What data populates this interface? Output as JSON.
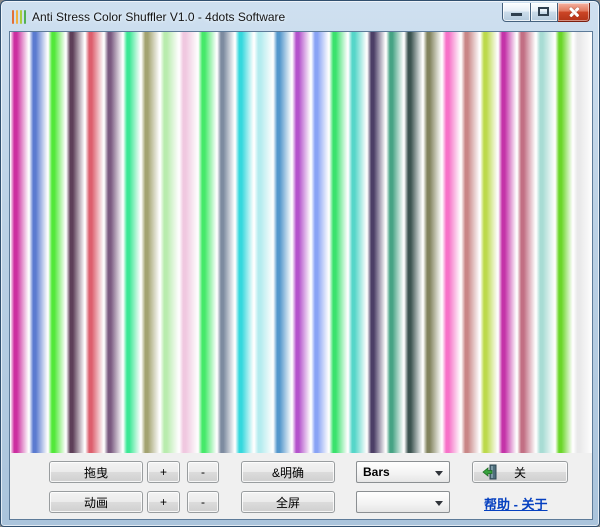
{
  "window": {
    "title": "Anti Stress Color Shuffler V1.0 - 4dots Software"
  },
  "bars": {
    "count": 31,
    "gradient_style": "white edge to saturated peak near 25% fading back to white",
    "colors": [
      "#cc2fa0",
      "#5b7bd0",
      "#52e83a",
      "#5e3f58",
      "#dd5f6d",
      "#7a5a80",
      "#3ce896",
      "#a3a371",
      "#b9ecae",
      "#f0c8e0",
      "#46e96a",
      "#7d8ba0",
      "#35d8dd",
      "#b5ecef",
      "#5497cc",
      "#b453cc",
      "#89a3f5",
      "#3be26d",
      "#56d6c9",
      "#4c3f66",
      "#46a384",
      "#3d5451",
      "#83845f",
      "#f772c8",
      "#c98787",
      "#bcd94b",
      "#c434a8",
      "#c26f84",
      "#a8dcd4",
      "#6ad628",
      "#e9e9ea"
    ]
  },
  "controls": {
    "row1": {
      "drag_label": "拖曳",
      "plus_label": "+",
      "minus_label": "-",
      "clear_label": "&明确",
      "style_combo_value": "Bars",
      "exit_label": "关"
    },
    "row2": {
      "animate_label": "动画",
      "plus_label": "+",
      "minus_label": "-",
      "fullscreen_label": "全屏",
      "combo2_value": "",
      "help_about_label": "帮助 - 关于"
    }
  },
  "colors": {
    "titlebar_glass": "#bcd2e6",
    "close_button_red": "#cc4526",
    "panel_gray": "#f0f0f0",
    "link_blue": "#0640c0"
  }
}
